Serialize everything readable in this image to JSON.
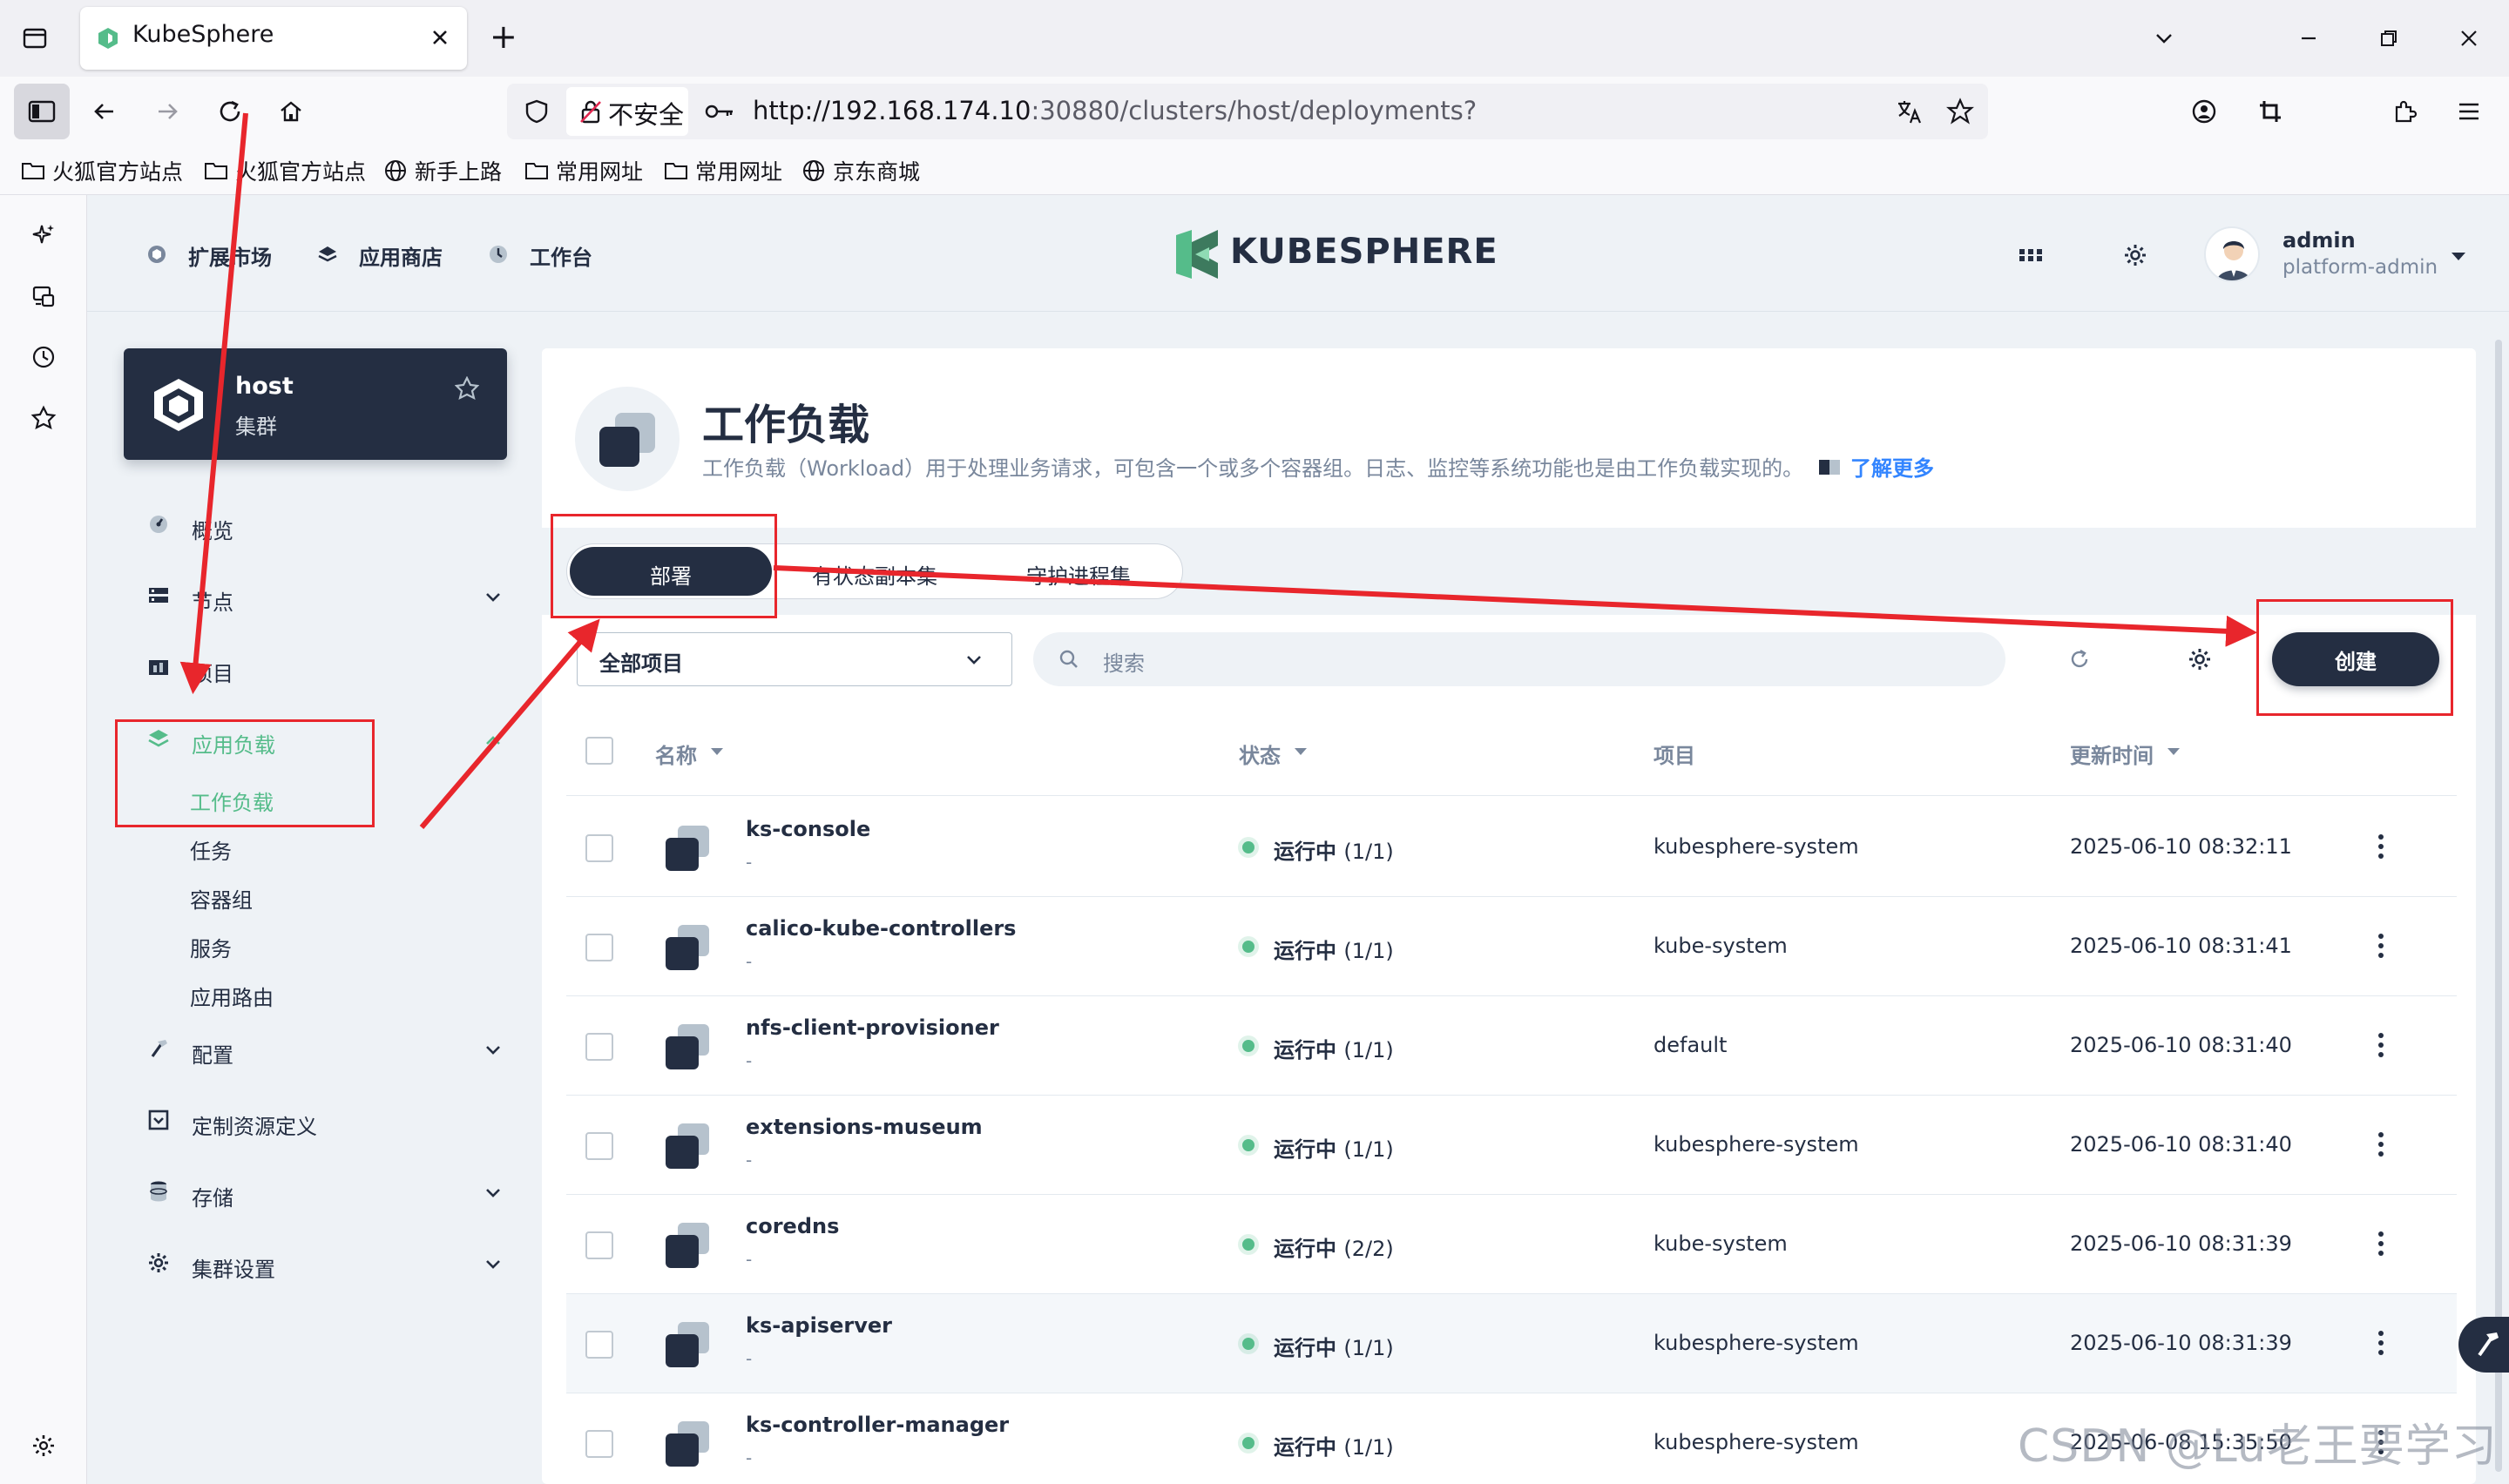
{
  "browser": {
    "tab_title": "KubeSphere",
    "new_tab": "+",
    "security_label": "不安全",
    "url_host": "http://192.168.174.10",
    "url_rest": ":30880/clusters/host/deployments?",
    "bookmarks": [
      "火狐官方站点",
      "火狐官方站点",
      "新手上路",
      "常用网址",
      "常用网址",
      "京东商城"
    ]
  },
  "header": {
    "nav": [
      "扩展市场",
      "应用商店",
      "工作台"
    ],
    "logo": "KUBESPHERE",
    "user_name": "admin",
    "user_role": "platform-admin"
  },
  "cluster": {
    "name": "host",
    "type": "集群"
  },
  "sidebar": {
    "items": [
      "概览",
      "节点",
      "项目",
      "应用负载",
      "配置",
      "定制资源定义",
      "存储",
      "集群设置"
    ],
    "workload_sub": [
      "工作负载",
      "任务",
      "容器组",
      "服务",
      "应用路由"
    ]
  },
  "page": {
    "title": "工作负载",
    "description": "工作负载（Workload）用于处理业务请求，可包含一个或多个容器组。日志、监控等系统功能也是由工作负载实现的。",
    "learn_more": "了解更多",
    "tabs": [
      "部署",
      "有状态副本集",
      "守护进程集"
    ],
    "project_select": "全部项目",
    "search_placeholder": "搜索",
    "create_label": "创建"
  },
  "table": {
    "headers": [
      "名称",
      "状态",
      "项目",
      "更新时间"
    ],
    "rows": [
      {
        "name": "ks-console",
        "desc": "-",
        "status": "运行中",
        "count": "(1/1)",
        "project": "kubesphere-system",
        "updated": "2025-06-10 08:32:11"
      },
      {
        "name": "calico-kube-controllers",
        "desc": "-",
        "status": "运行中",
        "count": "(1/1)",
        "project": "kube-system",
        "updated": "2025-06-10 08:31:41"
      },
      {
        "name": "nfs-client-provisioner",
        "desc": "-",
        "status": "运行中",
        "count": "(1/1)",
        "project": "default",
        "updated": "2025-06-10 08:31:40"
      },
      {
        "name": "extensions-museum",
        "desc": "-",
        "status": "运行中",
        "count": "(1/1)",
        "project": "kubesphere-system",
        "updated": "2025-06-10 08:31:40"
      },
      {
        "name": "coredns",
        "desc": "-",
        "status": "运行中",
        "count": "(2/2)",
        "project": "kube-system",
        "updated": "2025-06-10 08:31:39"
      },
      {
        "name": "ks-apiserver",
        "desc": "-",
        "status": "运行中",
        "count": "(1/1)",
        "project": "kubesphere-system",
        "updated": "2025-06-10 08:31:39"
      },
      {
        "name": "ks-controller-manager",
        "desc": "-",
        "status": "运行中",
        "count": "(1/1)",
        "project": "kubesphere-system",
        "updated": "2025-06-08 15:35:50"
      }
    ]
  },
  "watermark": "CSDN @Lu老王要学习",
  "colors": {
    "primary": "#242e42",
    "accent": "#55bc8a",
    "annotation": "#e8262c",
    "link": "#3385ff"
  }
}
